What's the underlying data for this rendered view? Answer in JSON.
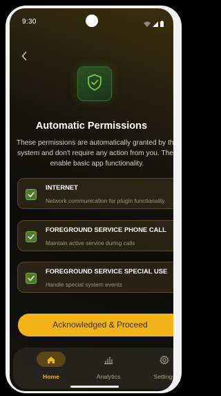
{
  "status_bar": {
    "time": "9:30"
  },
  "header": {
    "back_icon": "chevron-left-icon",
    "hero_icon": "shield-check-icon"
  },
  "page": {
    "title": "Automatic Permissions",
    "description": "These permissions are automatically granted by the system and don't require any action from you. They enable basic app functionality."
  },
  "permissions": [
    {
      "title": "INTERNET",
      "description": "Network communication for plugin functionality",
      "checked": true
    },
    {
      "title": "FOREGROUND SERVICE PHONE CALL",
      "description": "Maintain active service during calls",
      "checked": true
    },
    {
      "title": "FOREGROUND SERVICE SPECIAL USE",
      "description": "Handle special system events",
      "checked": true
    }
  ],
  "actions": {
    "proceed_label": "Acknowledged & Proceed"
  },
  "bottom_nav": {
    "items": [
      {
        "label": "Home",
        "icon": "home-icon",
        "active": true
      },
      {
        "label": "Analytics",
        "icon": "bar-chart-icon",
        "active": false
      },
      {
        "label": "Settings",
        "icon": "gear-icon",
        "active": false
      }
    ]
  },
  "colors": {
    "accent": "#f3b41a",
    "success": "#4f7a29",
    "background": "#0c0c0b"
  }
}
